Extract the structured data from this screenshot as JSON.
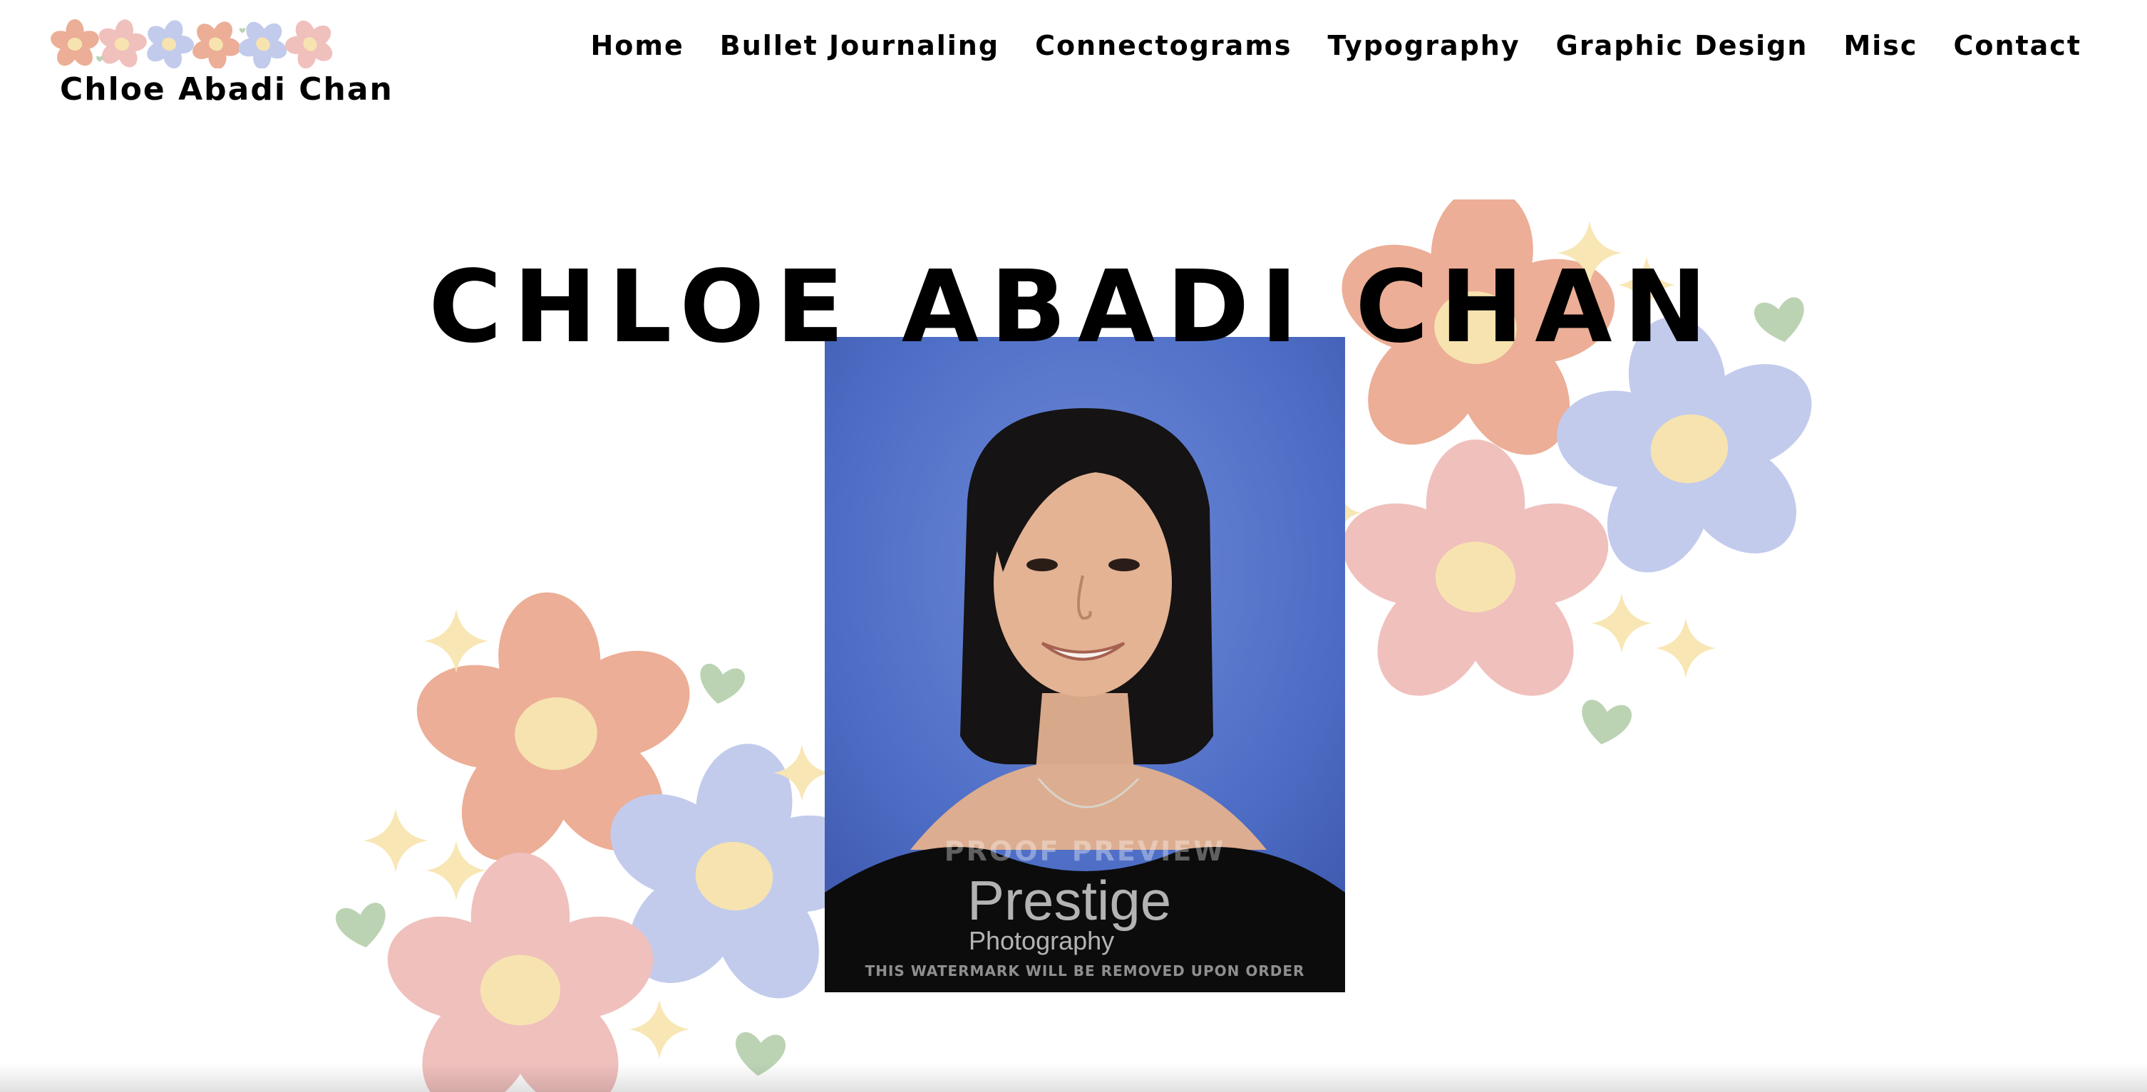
{
  "site": {
    "logo_text": "Chloe Abadi Chan"
  },
  "nav": {
    "items": [
      {
        "label": "Home"
      },
      {
        "label": "Bullet Journaling"
      },
      {
        "label": "Connectograms"
      },
      {
        "label": "Typography"
      },
      {
        "label": "Graphic Design"
      },
      {
        "label": "Misc"
      },
      {
        "label": "Contact"
      }
    ]
  },
  "hero": {
    "title": "CHLOE ABADI CHAN",
    "photo": {
      "watermark_top": "PROOF PREVIEW",
      "watermark_brand": "Prestige",
      "watermark_sub": "Photography",
      "watermark_bottom": "THIS WATERMARK WILL BE REMOVED UPON ORDER"
    }
  },
  "colors": {
    "flower_orange": "#ecae96",
    "flower_pink": "#f0c0bd",
    "flower_blue": "#c2cbec",
    "flower_center": "#f7e3b0",
    "sparkle": "#f8e6b4",
    "heart_green": "#bcd3b3",
    "photo_bg": "#4f6fc7"
  }
}
